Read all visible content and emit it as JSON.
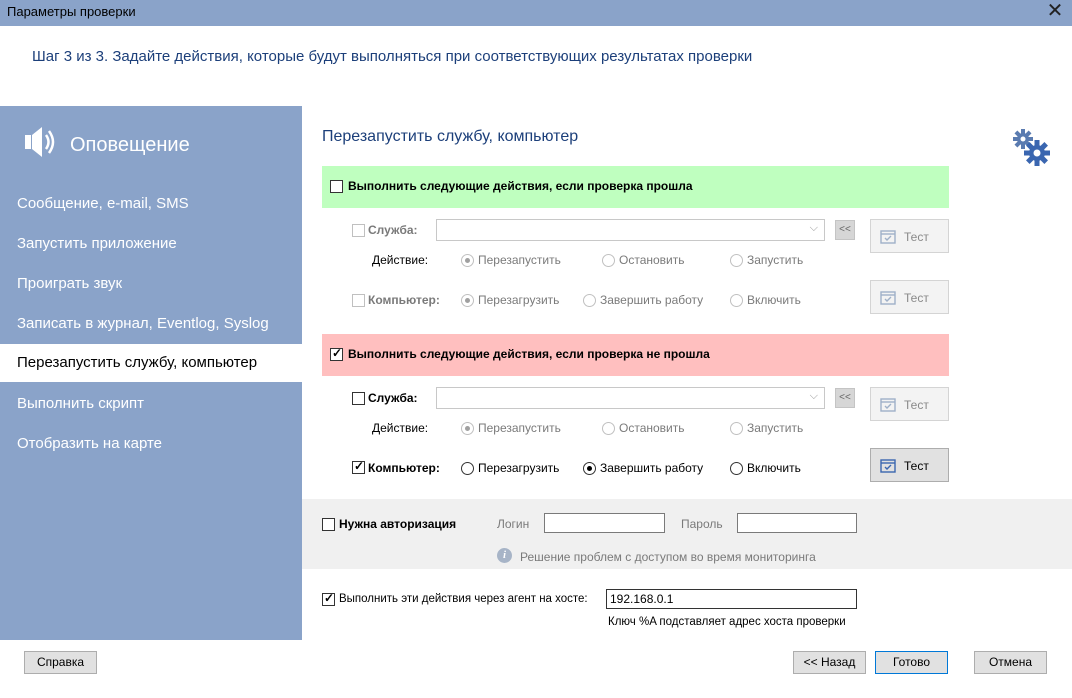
{
  "window": {
    "title": "Параметры проверки",
    "close_glyph": "✕"
  },
  "step_text": "Шаг 3 из 3. Задайте действия, которые будут выполняться при соответствующих результатах проверки",
  "sidebar": {
    "header": {
      "label": "Оповещение",
      "icon": "speaker-icon"
    },
    "items": [
      {
        "label": "Сообщение, e-mail, SMS"
      },
      {
        "label": "Запустить приложение"
      },
      {
        "label": "Проиграть звук"
      },
      {
        "label": "Записать в журнал, Eventlog, Syslog"
      },
      {
        "label": "Перезапустить службу, компьютер",
        "active": true
      },
      {
        "label": "Выполнить скрипт"
      },
      {
        "label": "Отобразить на карте"
      }
    ]
  },
  "section_title": "Перезапустить службу, компьютер",
  "success": {
    "checkbox_label": "Выполнить следующие действия, если проверка прошла",
    "checked": false,
    "service_label": "Служба:",
    "service_value": "",
    "service_button": "<<",
    "action_label": "Действие:",
    "service_actions": [
      "Перезапустить",
      "Остановить",
      "Запустить"
    ],
    "computer_label": "Компьютер:",
    "computer_actions": [
      "Перезагрузить",
      "Завершить работу",
      "Включить"
    ],
    "test_label": "Тест"
  },
  "failure": {
    "checkbox_label": "Выполнить следующие действия, если проверка не прошла",
    "checked": true,
    "service_label": "Служба:",
    "service_value": "",
    "service_button": "<<",
    "action_label": "Действие:",
    "service_actions": [
      "Перезапустить",
      "Остановить",
      "Запустить"
    ],
    "computer_label": "Компьютер:",
    "computer_checked": true,
    "computer_actions": [
      "Перезагрузить",
      "Завершить работу",
      "Включить"
    ],
    "computer_selected": "Завершить работу",
    "test_label": "Тест"
  },
  "auth": {
    "checkbox_label": "Нужна авторизация",
    "login_label": "Логин",
    "login_value": "",
    "password_label": "Пароль",
    "password_value": "",
    "help_text": "Решение проблем с доступом во время мониторинга"
  },
  "agent": {
    "checkbox_label": "Выполнить эти действия через агент на хосте:",
    "host_value": "192.168.0.1",
    "hint": "Ключ %A подставляет адрес хоста проверки"
  },
  "footer": {
    "help": "Справка",
    "back": "<< Назад",
    "done": "Готово",
    "cancel": "Отмена"
  },
  "colors": {
    "titlebar": "#8aa3c9",
    "sidebar": "#8aa3c9",
    "accent_text": "#1c3f7a",
    "success_band": "#bfffbf",
    "failure_band": "#ffbfbf"
  }
}
